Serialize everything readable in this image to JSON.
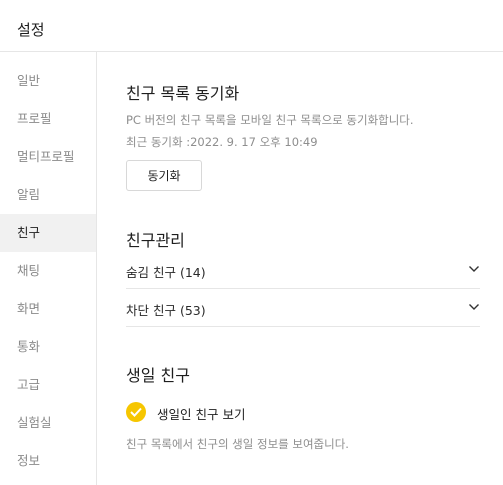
{
  "header": {
    "title": "설정"
  },
  "sidebar": {
    "items": [
      {
        "label": "일반"
      },
      {
        "label": "프로필"
      },
      {
        "label": "멀티프로필"
      },
      {
        "label": "알림"
      },
      {
        "label": "친구",
        "active": true
      },
      {
        "label": "채팅"
      },
      {
        "label": "화면"
      },
      {
        "label": "통화"
      },
      {
        "label": "고급"
      },
      {
        "label": "실험실"
      },
      {
        "label": "정보"
      }
    ]
  },
  "friend_sync": {
    "title": "친구 목록 동기화",
    "description": "PC 버전의 친구 목록을 모바일 친구 목록으로 동기화합니다.",
    "last_sync": "최근 동기화 :2022. 9. 17 오후 10:49",
    "button_label": "동기화"
  },
  "friend_manage": {
    "title": "친구관리",
    "rows": [
      {
        "label": "숨김 친구 (14)",
        "icon": "chevron-down-icon"
      },
      {
        "label": "차단 친구 (53)",
        "icon": "chevron-down-icon"
      }
    ]
  },
  "birthday": {
    "title": "생일 친구",
    "checkbox_label": "생일인 친구 보기",
    "checkbox_checked": true,
    "description": "친구 목록에서 친구의 생일 정보를 보여줍니다."
  },
  "colors": {
    "accent": "#f6c600",
    "active_bg": "#f1f1f1",
    "muted_text": "#8e8e8e",
    "divider": "#e6e6e6"
  }
}
